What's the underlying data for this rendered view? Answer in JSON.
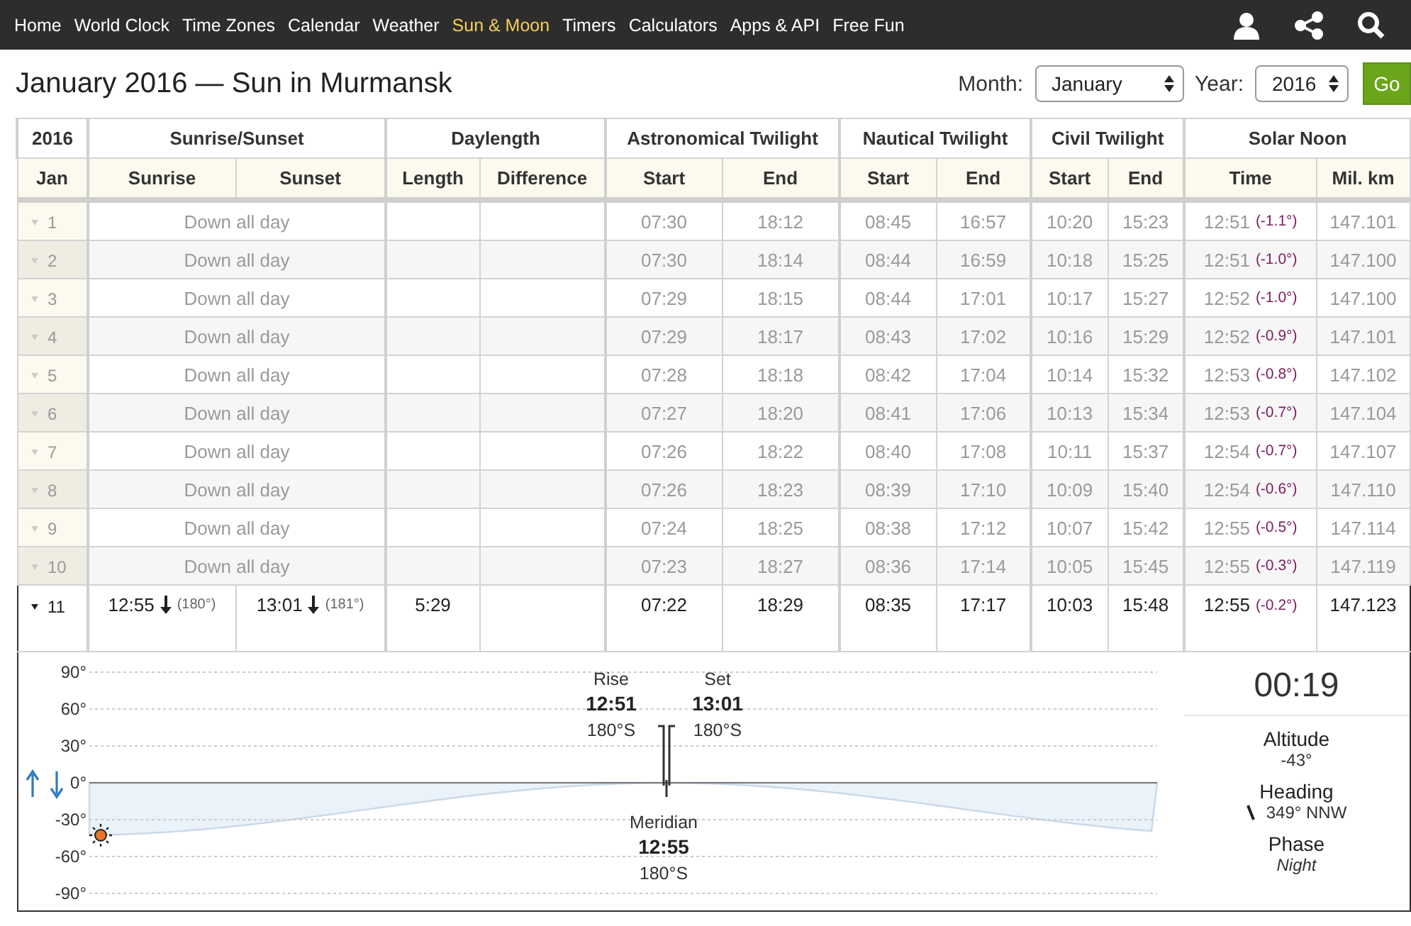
{
  "nav": {
    "items": [
      {
        "label": "Home",
        "selected": false
      },
      {
        "label": "World Clock",
        "selected": false
      },
      {
        "label": "Time Zones",
        "selected": false
      },
      {
        "label": "Calendar",
        "selected": false
      },
      {
        "label": "Weather",
        "selected": false
      },
      {
        "label": "Sun & Moon",
        "selected": true
      },
      {
        "label": "Timers",
        "selected": false
      },
      {
        "label": "Calculators",
        "selected": false
      },
      {
        "label": "Apps & API",
        "selected": false
      },
      {
        "label": "Free Fun",
        "selected": false
      }
    ]
  },
  "title": "January 2016 — Sun in Murmansk",
  "controls": {
    "month_label": "Month:",
    "month": "January",
    "year_label": "Year:",
    "year": "2016",
    "go": "Go"
  },
  "table": {
    "group_headers": [
      "2016",
      "Sunrise/Sunset",
      "Daylength",
      "Astronomical Twilight",
      "Nautical Twilight",
      "Civil Twilight",
      "Solar Noon"
    ],
    "columns": [
      "Jan",
      "Sunrise",
      "Sunset",
      "Length",
      "Difference",
      "Start",
      "End",
      "Start",
      "End",
      "Start",
      "End",
      "Time",
      "Mil. km"
    ],
    "rows": [
      {
        "kind": "down",
        "day": "1",
        "past": true,
        "expanded": false,
        "note": "Down all day",
        "times": [
          "07:30",
          "18:12",
          "08:45",
          "16:57",
          "10:20",
          "15:23"
        ],
        "noon": "12:51",
        "noon_angle": "(-1.1°)",
        "distance": "147.101"
      },
      {
        "kind": "down",
        "day": "2",
        "past": true,
        "expanded": false,
        "note": "Down all day",
        "times": [
          "07:30",
          "18:14",
          "08:44",
          "16:59",
          "10:18",
          "15:25"
        ],
        "noon": "12:51",
        "noon_angle": "(-1.0°)",
        "distance": "147.100"
      },
      {
        "kind": "down",
        "day": "3",
        "past": true,
        "expanded": false,
        "note": "Down all day",
        "times": [
          "07:29",
          "18:15",
          "08:44",
          "17:01",
          "10:17",
          "15:27"
        ],
        "noon": "12:52",
        "noon_angle": "(-1.0°)",
        "distance": "147.100"
      },
      {
        "kind": "down",
        "day": "4",
        "past": true,
        "expanded": false,
        "note": "Down all day",
        "times": [
          "07:29",
          "18:17",
          "08:43",
          "17:02",
          "10:16",
          "15:29"
        ],
        "noon": "12:52",
        "noon_angle": "(-0.9°)",
        "distance": "147.101"
      },
      {
        "kind": "down",
        "day": "5",
        "past": true,
        "expanded": false,
        "note": "Down all day",
        "times": [
          "07:28",
          "18:18",
          "08:42",
          "17:04",
          "10:14",
          "15:32"
        ],
        "noon": "12:53",
        "noon_angle": "(-0.8°)",
        "distance": "147.102"
      },
      {
        "kind": "down",
        "day": "6",
        "past": true,
        "expanded": false,
        "note": "Down all day",
        "times": [
          "07:27",
          "18:20",
          "08:41",
          "17:06",
          "10:13",
          "15:34"
        ],
        "noon": "12:53",
        "noon_angle": "(-0.7°)",
        "distance": "147.104"
      },
      {
        "kind": "down",
        "day": "7",
        "past": true,
        "expanded": false,
        "note": "Down all day",
        "times": [
          "07:26",
          "18:22",
          "08:40",
          "17:08",
          "10:11",
          "15:37"
        ],
        "noon": "12:54",
        "noon_angle": "(-0.7°)",
        "distance": "147.107"
      },
      {
        "kind": "down",
        "day": "8",
        "past": true,
        "expanded": false,
        "note": "Down all day",
        "times": [
          "07:26",
          "18:23",
          "08:39",
          "17:10",
          "10:09",
          "15:40"
        ],
        "noon": "12:54",
        "noon_angle": "(-0.6°)",
        "distance": "147.110"
      },
      {
        "kind": "down",
        "day": "9",
        "past": true,
        "expanded": false,
        "note": "Down all day",
        "times": [
          "07:24",
          "18:25",
          "08:38",
          "17:12",
          "10:07",
          "15:42"
        ],
        "noon": "12:55",
        "noon_angle": "(-0.5°)",
        "distance": "147.114"
      },
      {
        "kind": "down",
        "day": "10",
        "past": true,
        "expanded": false,
        "note": "Down all day",
        "times": [
          "07:23",
          "18:27",
          "08:36",
          "17:14",
          "10:05",
          "15:45"
        ],
        "noon": "12:55",
        "noon_angle": "(-0.3°)",
        "distance": "147.119"
      },
      {
        "kind": "sun",
        "day": "11",
        "past": false,
        "expanded": true,
        "sunrise": {
          "time": "12:55",
          "angle": "(180°)"
        },
        "sunset": {
          "time": "13:01",
          "angle": "(181°)"
        },
        "length": "5:29",
        "times": [
          "07:22",
          "18:29",
          "08:35",
          "17:17",
          "10:03",
          "15:48"
        ],
        "noon": "12:55",
        "noon_angle": "(-0.2°)",
        "distance": "147.123"
      }
    ]
  },
  "details": {
    "altitude_ticks": [
      "90°",
      "60°",
      "30°",
      "0°",
      "-30°",
      "-60°",
      "-90°"
    ],
    "rise": {
      "label": "Rise",
      "time": "12:51",
      "direction": "180°S"
    },
    "set": {
      "label": "Set",
      "time": "13:01",
      "direction": "180°S"
    },
    "meridian": {
      "label": "Meridian",
      "time": "12:55",
      "direction": "180°S"
    },
    "time": "00:19",
    "altitude_label": "Altitude",
    "altitude": "-43°",
    "heading_label": "Heading",
    "heading": "349° NNW",
    "phase_label": "Phase",
    "phase": "Night"
  }
}
